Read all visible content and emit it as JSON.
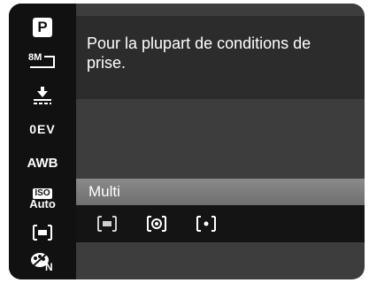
{
  "sidebar": {
    "items": [
      {
        "icon": "program-mode-icon",
        "text": "P"
      },
      {
        "icon": "resolution-8m-icon",
        "text": "8M"
      },
      {
        "icon": "quality-icon",
        "text": ""
      },
      {
        "icon": "exposure-icon",
        "text": "0EV"
      },
      {
        "icon": "white-balance-icon",
        "text": "AWB"
      },
      {
        "icon": "iso-icon",
        "text_top": "ISO",
        "text_bottom": "Auto"
      },
      {
        "icon": "metering-icon",
        "text": ""
      },
      {
        "icon": "color-mode-icon",
        "text": "N"
      }
    ]
  },
  "description": {
    "text": "Pour la plupart de conditions de prise."
  },
  "metering": {
    "selected_label": "Multi",
    "options": [
      {
        "icon": "multi-metering-icon"
      },
      {
        "icon": "center-metering-icon"
      },
      {
        "icon": "spot-metering-icon"
      }
    ]
  },
  "colors": {
    "screen_bg": "#3d3d3d",
    "sidebar_bg": "#111111",
    "highlight": "#7a7a7a"
  }
}
